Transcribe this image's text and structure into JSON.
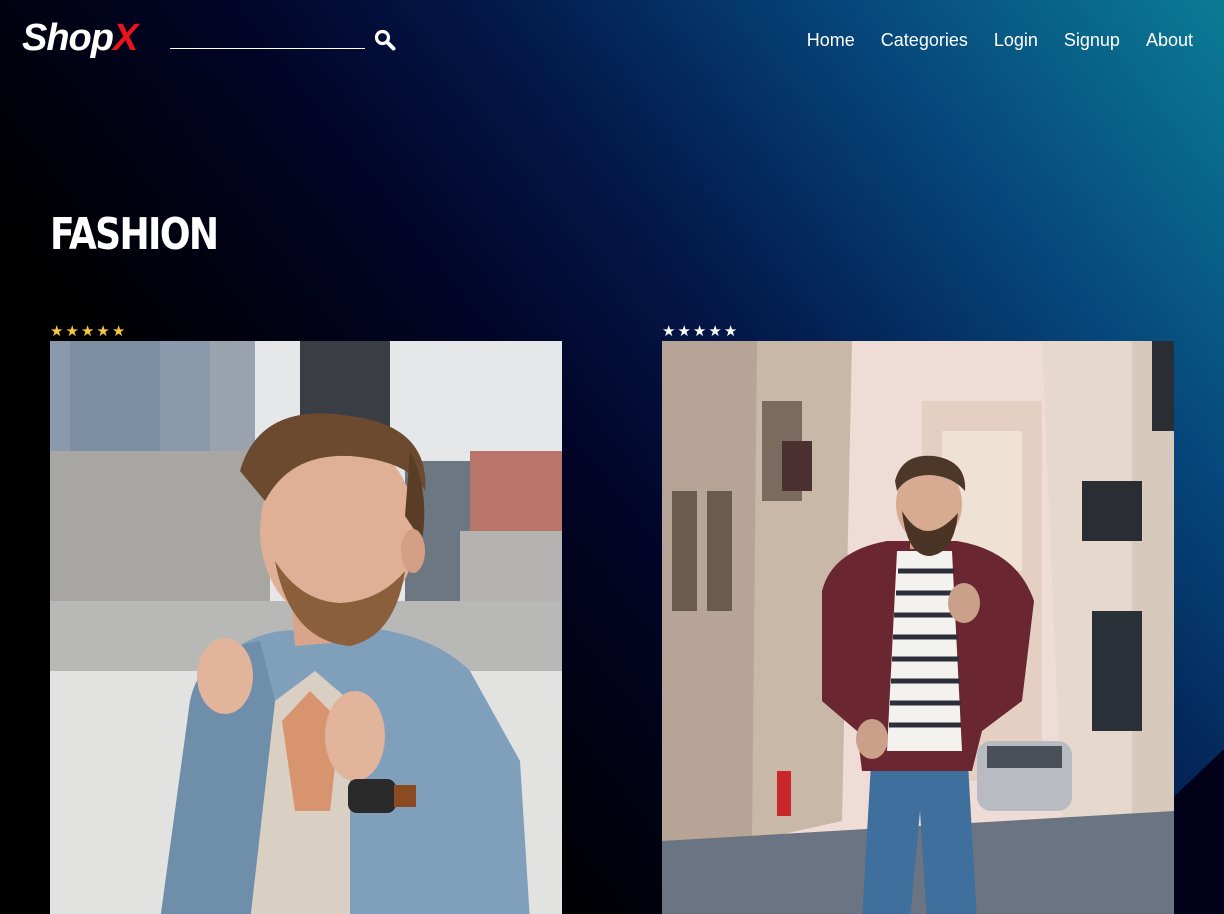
{
  "header": {
    "logo_main": "Shop",
    "logo_accent": "X",
    "search": {
      "value": "",
      "placeholder": ""
    },
    "nav": [
      {
        "label": "Home"
      },
      {
        "label": "Categories"
      },
      {
        "label": "Login"
      },
      {
        "label": "Signup"
      },
      {
        "label": "About"
      }
    ]
  },
  "section": {
    "title": "FASHION"
  },
  "products": [
    {
      "rating": 5,
      "star_color": "#f5c842",
      "image": "man-in-denim-jacket-photo"
    },
    {
      "rating": 5,
      "star_color": "#ffffff",
      "image": "man-in-burgundy-bomber-jacket-street-photo"
    }
  ],
  "colors": {
    "brand_accent": "#e8141b",
    "text": "#ffffff"
  },
  "icons": {
    "search": "search-icon",
    "star": "star-icon"
  }
}
